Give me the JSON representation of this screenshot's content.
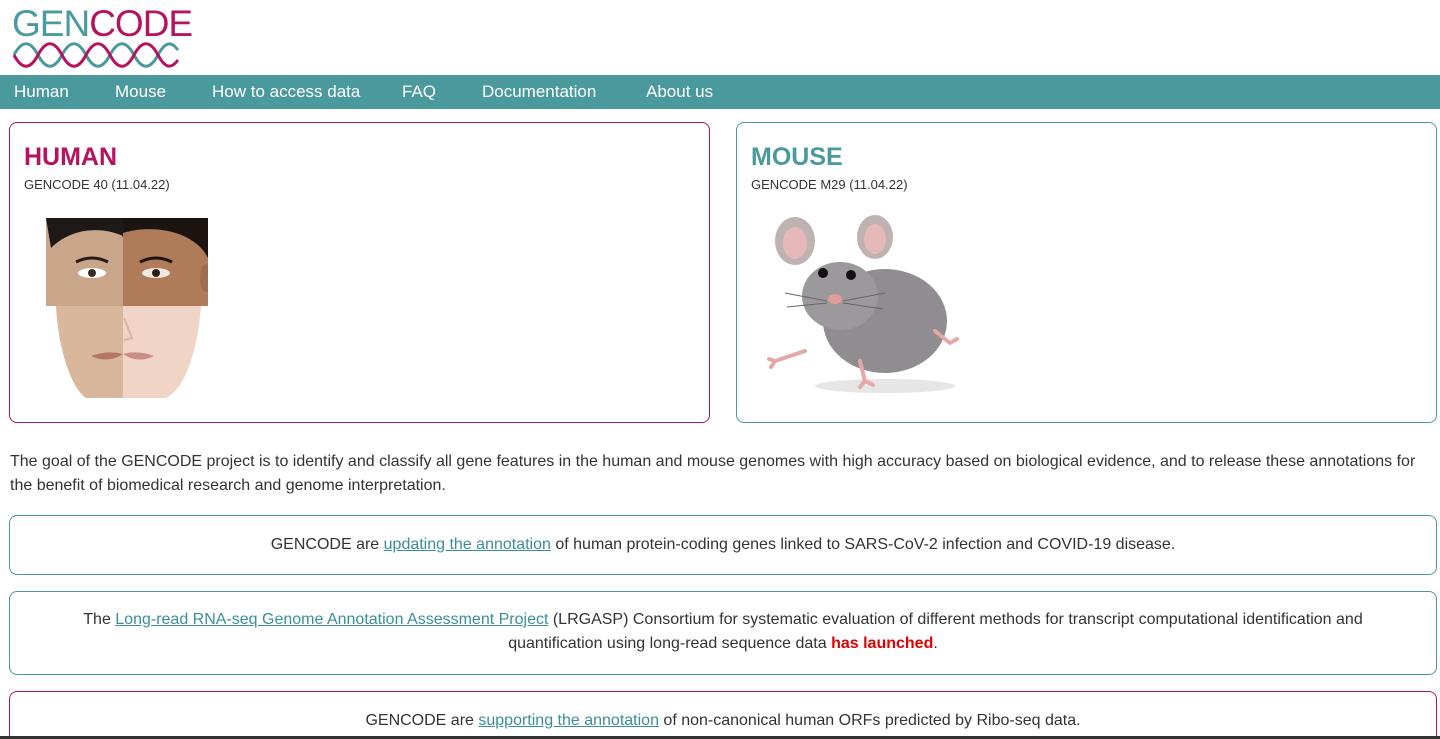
{
  "logo": {
    "part1": "GEN",
    "part2": "CODE"
  },
  "nav": {
    "items": [
      {
        "label": "Human"
      },
      {
        "label": "Mouse"
      },
      {
        "label": "How to access data"
      },
      {
        "label": "FAQ"
      },
      {
        "label": "Documentation"
      },
      {
        "label": "About us"
      }
    ]
  },
  "cards": {
    "human": {
      "title": "HUMAN",
      "release": "GENCODE 40 (11.04.22)"
    },
    "mouse": {
      "title": "MOUSE",
      "release": "GENCODE M29 (11.04.22)"
    }
  },
  "intro": "The goal of the GENCODE project is to identify and classify all gene features in the human and mouse genomes with high accuracy based on biological evidence, and to release these annotations for the benefit of biomedical research and genome interpretation.",
  "news": {
    "covid": {
      "prefix": "GENCODE are ",
      "link": "updating the annotation",
      "suffix": " of human protein-coding genes linked to SARS-CoV-2 infection and COVID-19 disease."
    },
    "lrgasp": {
      "prefix": "The ",
      "link": "Long-read RNA-seq Genome Annotation Assessment Project",
      "middle": " (LRGASP) Consortium for systematic evaluation of different methods for transcript computational identification and quantification using long-read sequence data ",
      "alert": "has launched",
      "suffix": "."
    },
    "riboseq": {
      "prefix": "GENCODE are ",
      "link": "supporting the annotation",
      "suffix": " of non-canonical human ORFs predicted by Ribo-seq data."
    }
  },
  "colors": {
    "teal": "#4a999d",
    "magenta": "#b5135f",
    "alert": "#e00000"
  }
}
